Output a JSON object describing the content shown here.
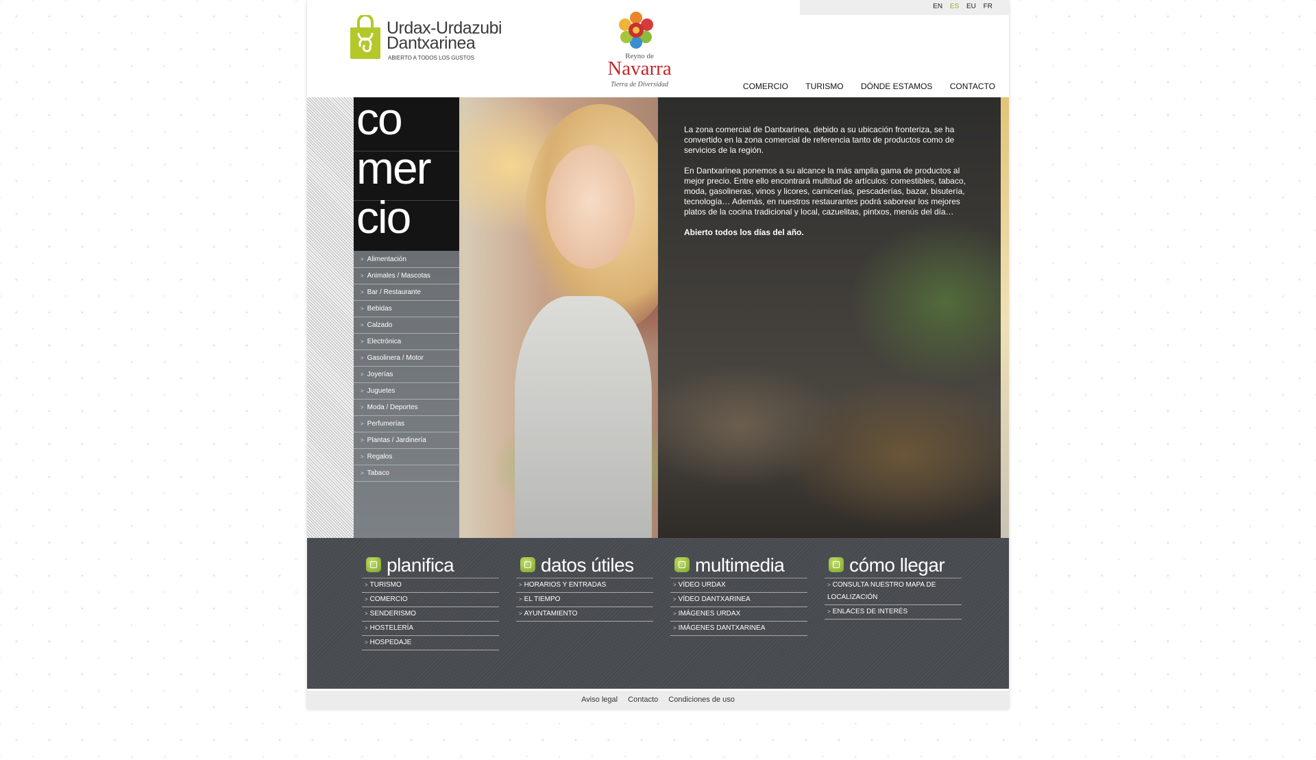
{
  "languages": [
    {
      "code": "EN",
      "active": false
    },
    {
      "code": "ES",
      "active": true
    },
    {
      "code": "EU",
      "active": false
    },
    {
      "code": "FR",
      "active": false
    }
  ],
  "brand": {
    "line1": "Urdax-Urdazubi",
    "line2": "Dantxarinea",
    "tagline": "ABIERTO A TODOS LOS GUSTOS"
  },
  "navarra": {
    "small": "Reyno de",
    "big": "Navarra",
    "sub": "Tierra de Diversidad"
  },
  "nav": [
    "COMERCIO",
    "TURISMO",
    "DÓNDE ESTAMOS",
    "CONTACTO"
  ],
  "side": {
    "title_lines": [
      "co",
      "mer",
      "cio"
    ],
    "menu": [
      "Alimentación",
      "Animales / Mascotas",
      "Bar / Restaurante",
      "Bebidas",
      "Calzado",
      "Electrónica",
      "Gasolinera / Motor",
      "Joyerías",
      "Juguetes",
      "Moda / Deportes",
      "Perfumerías",
      "Plantas / Jardinería",
      "Regalos",
      "Tabaco"
    ]
  },
  "hero": {
    "p1": "La zona comercial de Dantxarinea, debido a su ubicación fronteriza, se ha convertido en la zona comercial de referencia tanto de productos como de servicios de la región.",
    "p2": "En Dantxarinea ponemos a su alcance la más amplia gama de productos al mejor precio. Entre ello encontrará multitud de artículos: comestibles, tabaco, moda, gasolineras, vinos y licores, carnicerías, pescaderías, bazar, bisutería, tecnología… Además, en nuestros restaurantes podrá saborear los mejores platos de la cocina tradicional y local, cazuelitas, pintxos, menús del día…",
    "p3": "Abierto todos los días del año."
  },
  "columns": [
    {
      "title": "planifica",
      "icon": "calendar-icon",
      "links": [
        "TURISMO",
        "COMERCIO",
        "SENDERISMO",
        "HOSTELERÍA",
        "HOSPEDAJE"
      ]
    },
    {
      "title": "datos útiles",
      "icon": "info-chart-icon",
      "links": [
        "HORARIOS Y ENTRADAS",
        "EL TIEMPO",
        "AYUNTAMIENTO"
      ]
    },
    {
      "title": "multimedia",
      "icon": "camera-icon",
      "links": [
        "VÍDEO URDAX",
        "VÍDEO DANTXARINEA",
        "IMÁGENES URDAX",
        "IMÁGENES DANTXARINEA"
      ]
    },
    {
      "title": "cómo llegar",
      "icon": "map-icon",
      "links": [
        "CONSULTA NUESTRO MAPA DE LOCALIZACIÓN",
        "ENLACES DE INTERÉS"
      ]
    }
  ],
  "footer": [
    "Aviso legal",
    "Contacto",
    "Condiciones de uso"
  ],
  "colors": {
    "accent_green": "#8fb22c",
    "panel_dark": "#484b50",
    "navarra_red": "#c1272d"
  }
}
